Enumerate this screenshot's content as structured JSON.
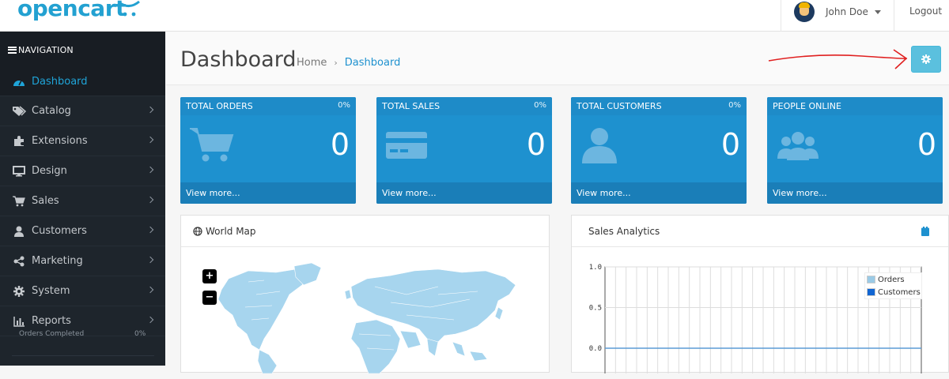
{
  "header": {
    "logo_text": "opencart",
    "user_name": "John Doe",
    "logout_label": "Logout"
  },
  "sidebar": {
    "nav_title": "NAVIGATION",
    "items": [
      {
        "label": "Dashboard",
        "icon": "dashboard-icon",
        "active": true
      },
      {
        "label": "Catalog",
        "icon": "tags-icon"
      },
      {
        "label": "Extensions",
        "icon": "puzzle-icon"
      },
      {
        "label": "Design",
        "icon": "monitor-icon"
      },
      {
        "label": "Sales",
        "icon": "cart-icon"
      },
      {
        "label": "Customers",
        "icon": "user-icon"
      },
      {
        "label": "Marketing",
        "icon": "share-icon"
      },
      {
        "label": "System",
        "icon": "gear-icon"
      },
      {
        "label": "Reports",
        "icon": "bar-chart-icon"
      }
    ],
    "bottom_text": "Orders Completed",
    "bottom_pct": "0%"
  },
  "page": {
    "title": "Dashboard",
    "breadcrumb": [
      "Home",
      "Dashboard"
    ]
  },
  "tiles": [
    {
      "title": "TOTAL ORDERS",
      "pct": "0%",
      "value": "0",
      "link": "View more...",
      "icon": "cart-icon"
    },
    {
      "title": "TOTAL SALES",
      "pct": "0%",
      "value": "0",
      "link": "View more...",
      "icon": "credit-card-icon"
    },
    {
      "title": "TOTAL CUSTOMERS",
      "pct": "0%",
      "value": "0",
      "link": "View more...",
      "icon": "user-icon"
    },
    {
      "title": "PEOPLE ONLINE",
      "pct": "",
      "value": "0",
      "link": "View more...",
      "icon": "users-icon"
    }
  ],
  "world_map": {
    "title": "World Map",
    "zoom_in": "+",
    "zoom_out": "−"
  },
  "sales_analytics": {
    "title": "Sales Analytics",
    "legend": [
      {
        "name": "Orders",
        "color": "#9acae6"
      },
      {
        "name": "Customers",
        "color": "#1065d2"
      }
    ],
    "y_ticks": [
      "1.0",
      "0.5",
      "0.0"
    ]
  },
  "colors": {
    "accent": "#1e91cf",
    "sidebar": "#1e252c",
    "settings_button": "#5bc0de",
    "annotation_arrow": "#e02020"
  }
}
